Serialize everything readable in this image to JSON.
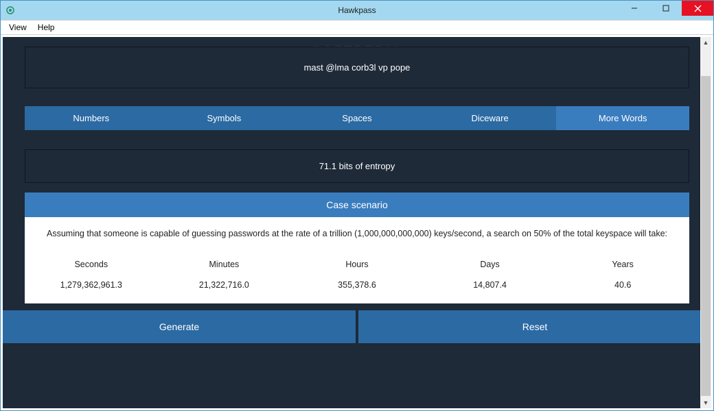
{
  "window": {
    "title": "Hawkpass"
  },
  "menu": {
    "view": "View",
    "help": "Help"
  },
  "watermark": "SOFTPEDIA",
  "password": "mast @lma corb3l vp pope",
  "options": {
    "numbers": "Numbers",
    "symbols": "Symbols",
    "spaces": "Spaces",
    "diceware": "Diceware",
    "morewords": "More Words"
  },
  "entropy": "71.1 bits of entropy",
  "scenario": {
    "title": "Case scenario",
    "description": "Assuming that someone is capable of guessing passwords at the rate of a trillion (1,000,000,000,000) keys/second, a search on 50% of the total keyspace will take:",
    "columns": [
      {
        "header": "Seconds",
        "value": "1,279,362,961.3"
      },
      {
        "header": "Minutes",
        "value": "21,322,716.0"
      },
      {
        "header": "Hours",
        "value": "355,378.6"
      },
      {
        "header": "Days",
        "value": "14,807.4"
      },
      {
        "header": "Years",
        "value": "40.6"
      }
    ]
  },
  "actions": {
    "generate": "Generate",
    "reset": "Reset"
  }
}
